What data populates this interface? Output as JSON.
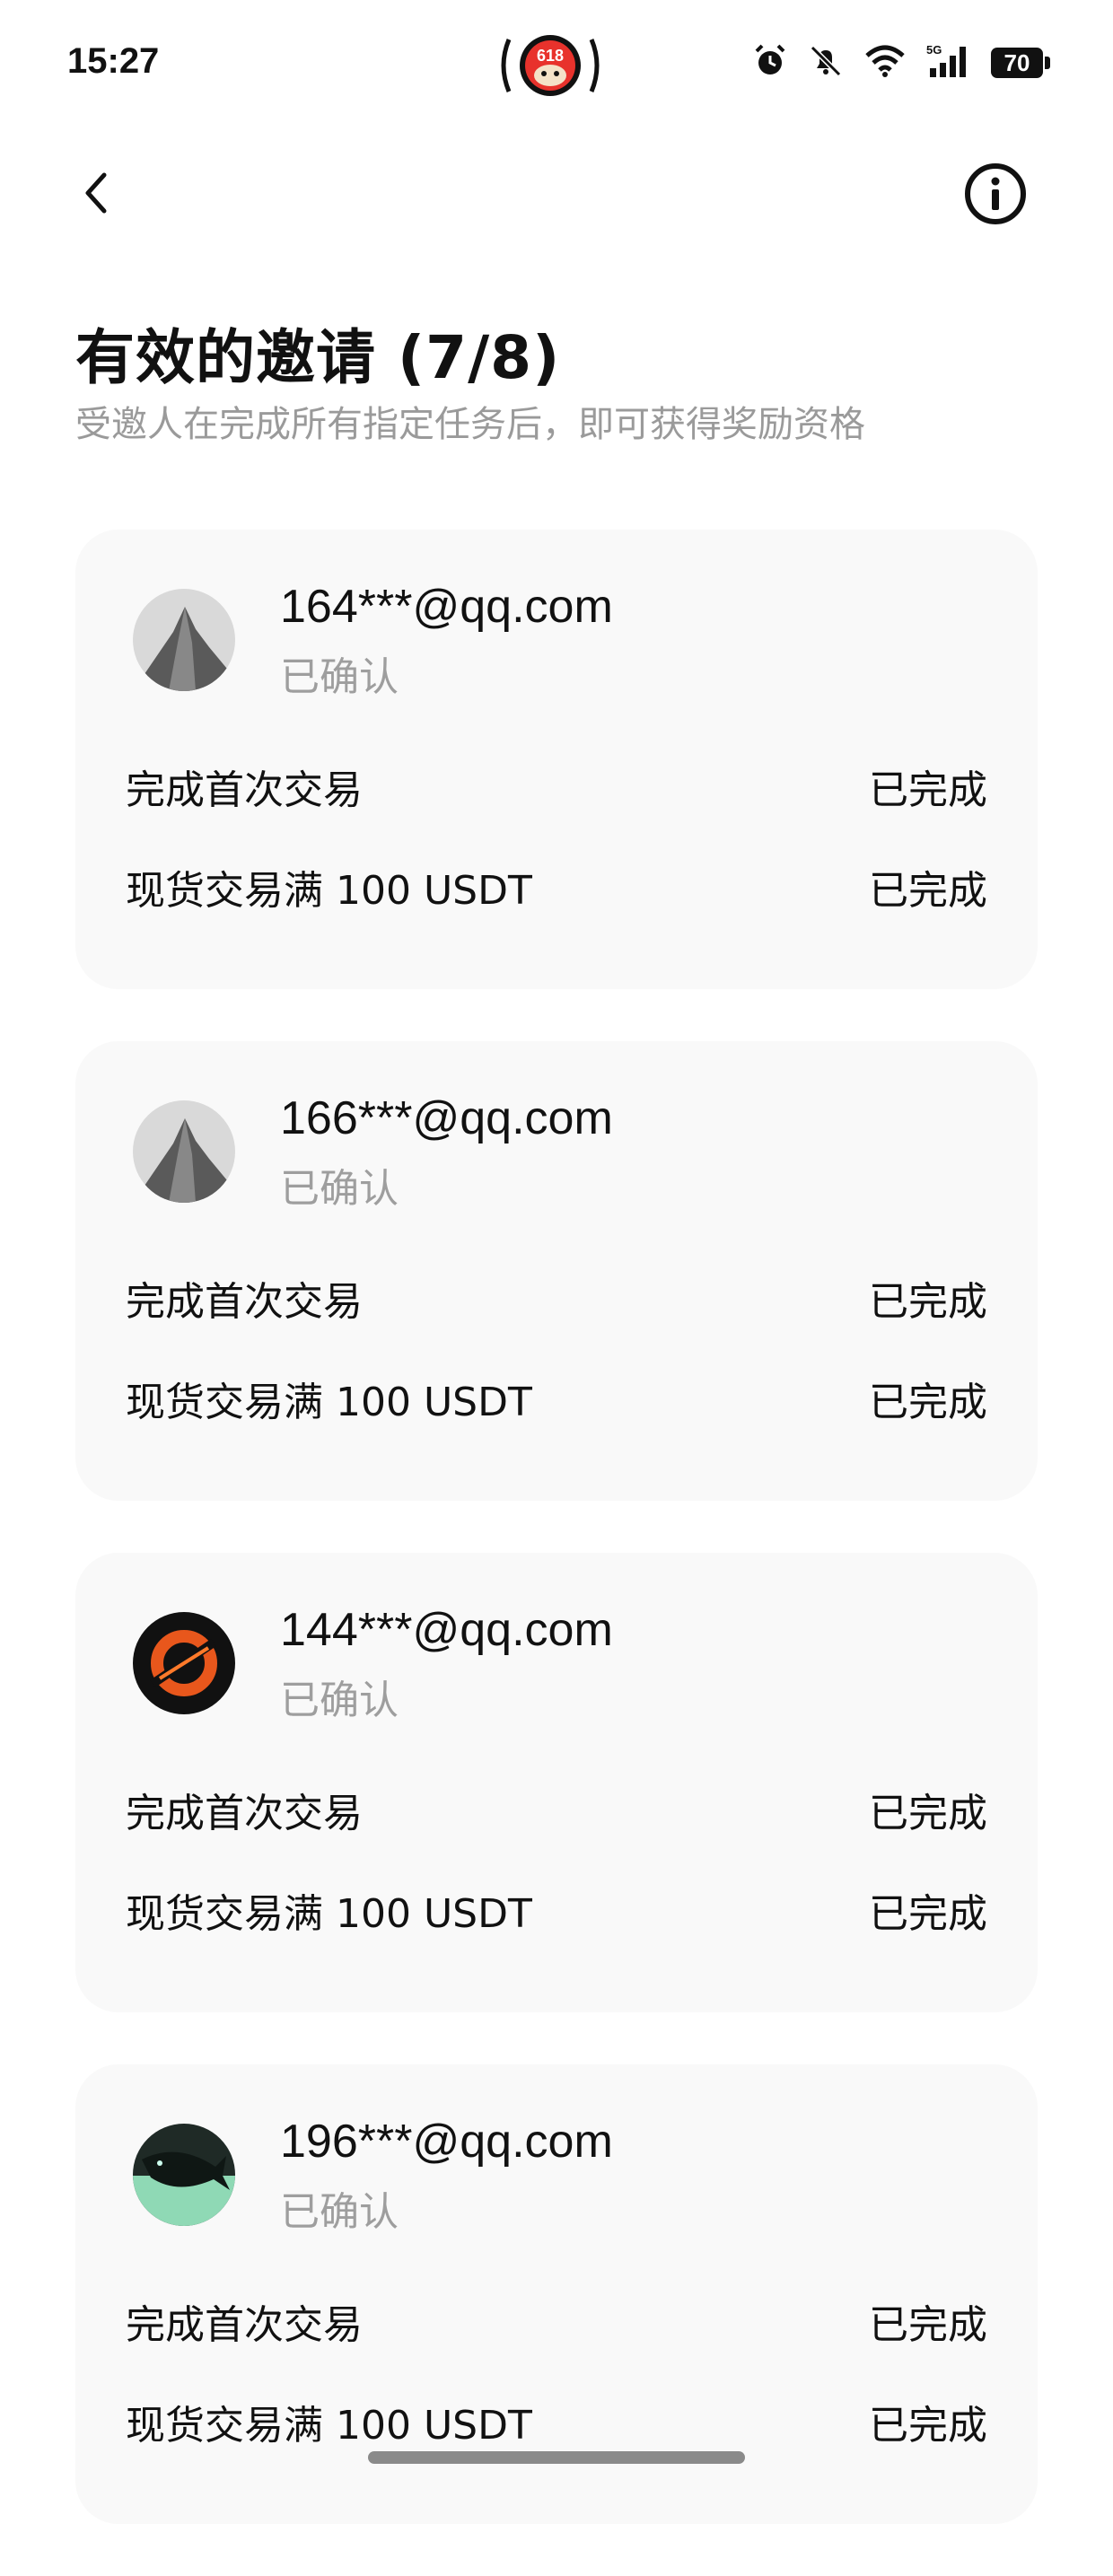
{
  "status_bar": {
    "time": "15:27",
    "center_badge": "618",
    "network": "5G",
    "battery": "70"
  },
  "header": {
    "title": "有效的邀请 (7/8)",
    "subtitle": "受邀人在完成所有指定任务后，即可获得奖励资格"
  },
  "invitations": [
    {
      "email": "164***@qq.com",
      "status": "已确认",
      "avatar": "mountain-avatar",
      "tasks": [
        {
          "name": "完成首次交易",
          "status": "已完成"
        },
        {
          "name": "现货交易满 100 USDT",
          "status": "已完成"
        }
      ]
    },
    {
      "email": "166***@qq.com",
      "status": "已确认",
      "avatar": "mountain-avatar",
      "tasks": [
        {
          "name": "完成首次交易",
          "status": "已完成"
        },
        {
          "name": "现货交易满 100 USDT",
          "status": "已完成"
        }
      ]
    },
    {
      "email": "144***@qq.com",
      "status": "已确认",
      "avatar": "orange-planet-avatar",
      "tasks": [
        {
          "name": "完成首次交易",
          "status": "已完成"
        },
        {
          "name": "现货交易满 100 USDT",
          "status": "已完成"
        }
      ]
    },
    {
      "email": "196***@qq.com",
      "status": "已确认",
      "avatar": "whale-avatar",
      "tasks": [
        {
          "name": "完成首次交易",
          "status": "已完成"
        },
        {
          "name": "现货交易满 100 USDT",
          "status": "已完成"
        }
      ]
    }
  ]
}
